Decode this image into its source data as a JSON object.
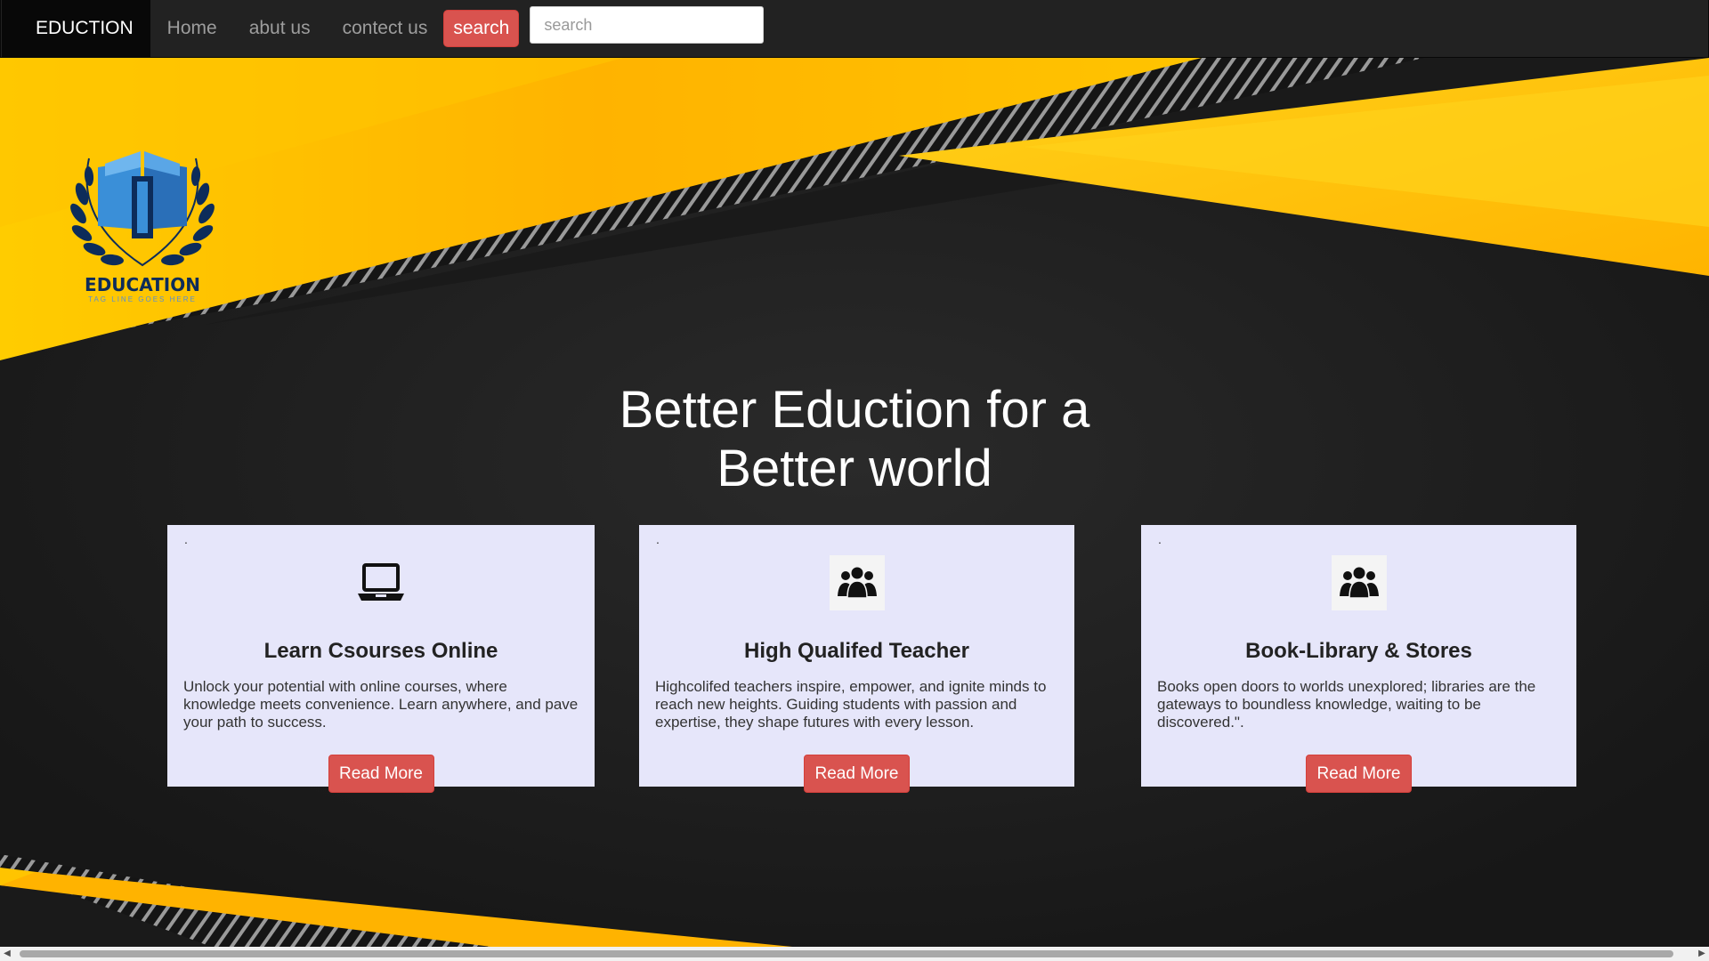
{
  "navbar": {
    "brand": "EDUCTION",
    "links": [
      "Home",
      "abut us",
      "contect us"
    ],
    "search_button": "search",
    "search_placeholder": "search"
  },
  "logo": {
    "title": "EDUCATION",
    "tagline": "TAG LINE GOES HERE",
    "icon": "open-book-laurel-icon"
  },
  "hero": {
    "headline_line1": "Better Eduction for a",
    "headline_line2": "Better world"
  },
  "cards": [
    {
      "marker": ".",
      "icon": "laptop-icon",
      "title": "Learn Csourses Online",
      "text": "Unlock your potential with online courses, where knowledge meets convenience. Learn anywhere, and pave your path to success.",
      "button": "Read More"
    },
    {
      "marker": ".",
      "icon": "group-icon",
      "title": "High Qualifed Teacher",
      "text": "Highcolifed teachers inspire, empower, and ignite minds to reach new heights. Guiding students with passion and expertise, they shape futures with every lesson.",
      "button": "Read More"
    },
    {
      "marker": ".",
      "icon": "group-icon",
      "title": "Book-Library & Stores",
      "text": "Books open doors to worlds unexplored; libraries are the gateways to boundless knowledge, waiting to be discovered.\".",
      "button": "Read More"
    }
  ],
  "colors": {
    "navbar_bg": "#222222",
    "brand_bg": "#080808",
    "accent_red": "#d9534f",
    "hero_yellow": "#ffc107",
    "hero_dark": "#1f1f1f",
    "card_bg": "#e6e6fa"
  }
}
